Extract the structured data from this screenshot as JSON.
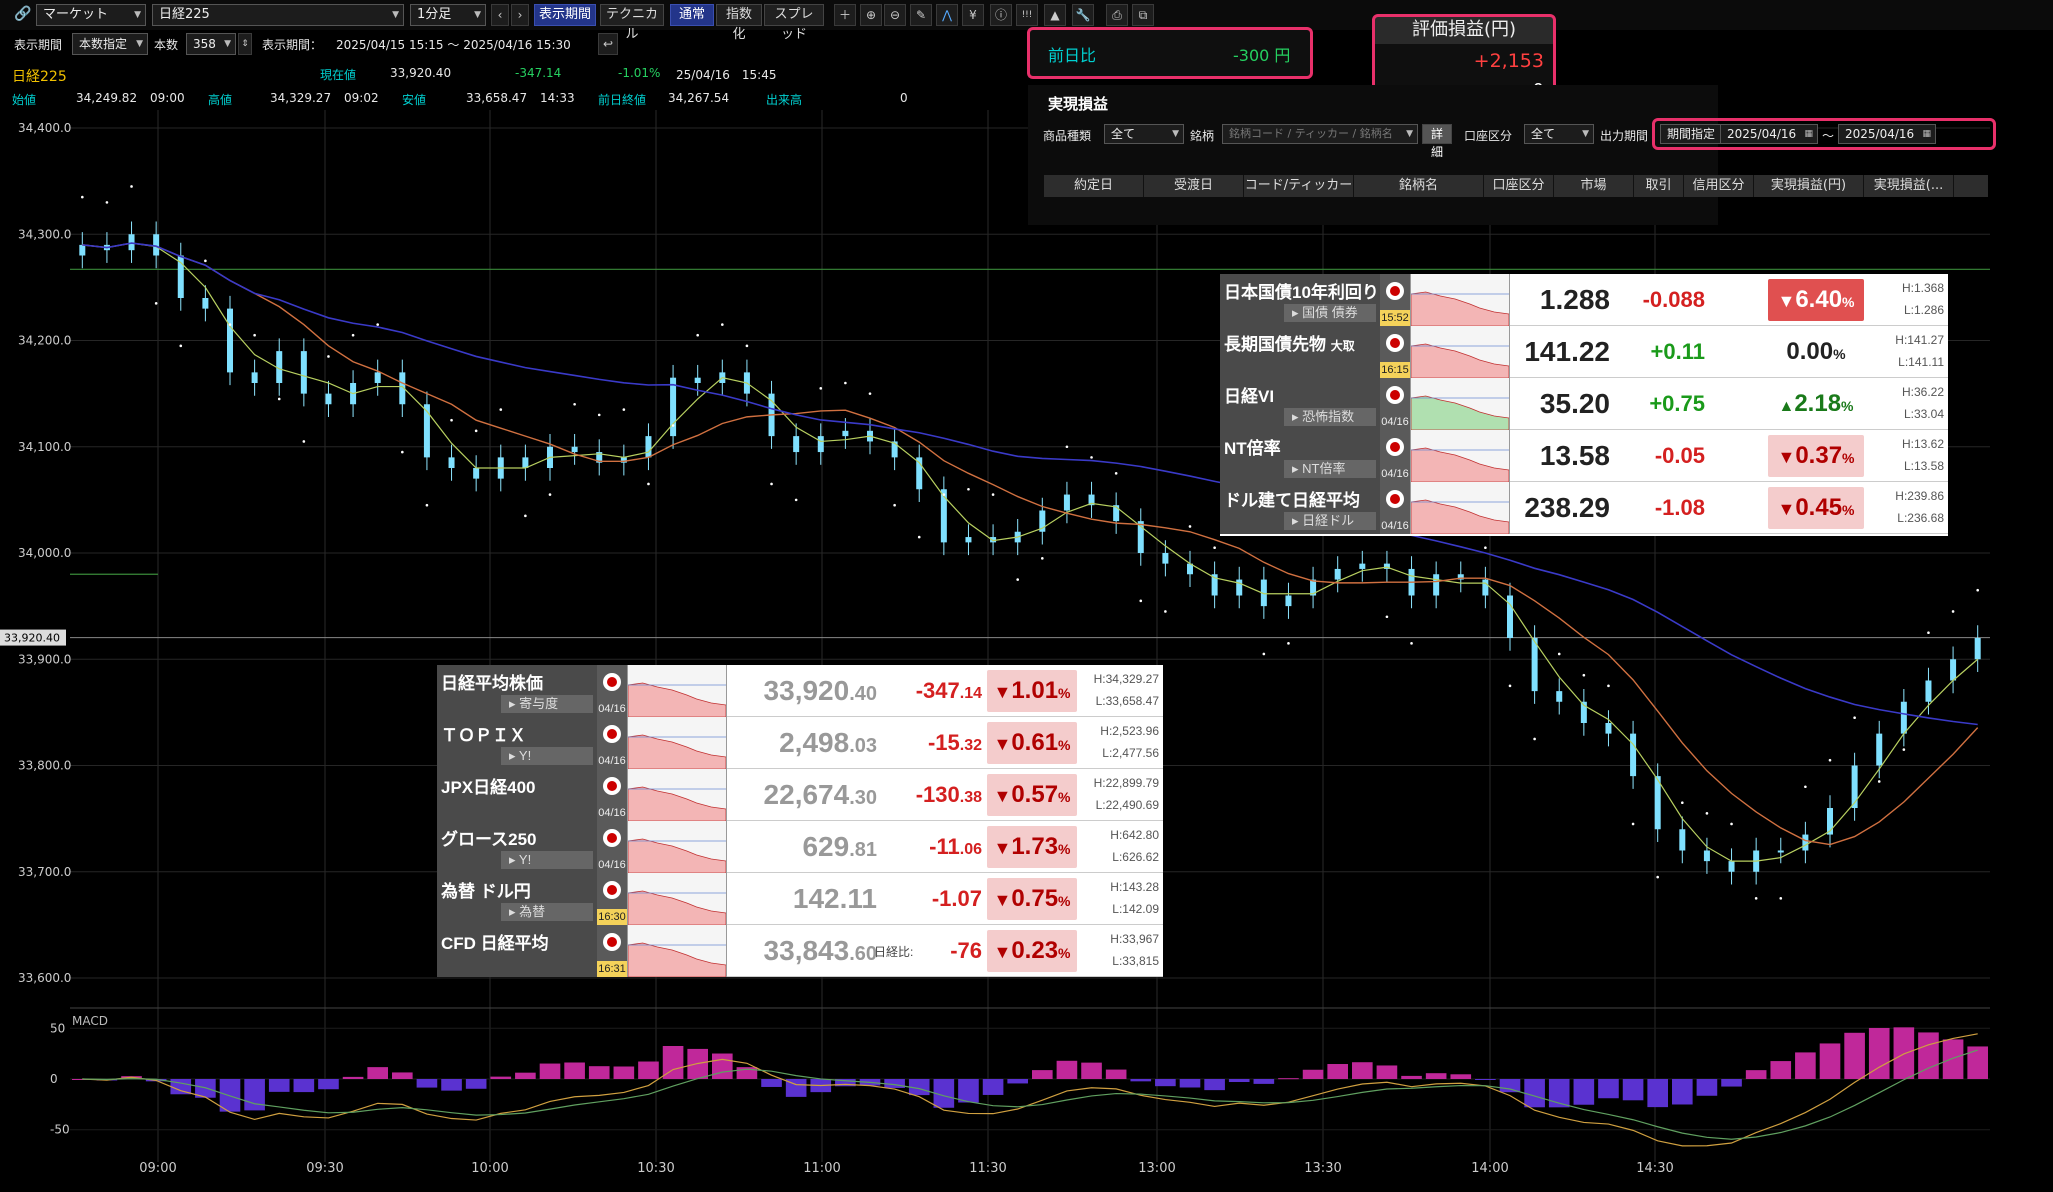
{
  "toolbar": {
    "link_icon": "link-icon",
    "market_select": "マーケット",
    "symbol_select": "日経225",
    "interval_select": "1分足",
    "btn_period": "表示期間",
    "btn_technical": "テクニカル",
    "btn_normal": "通常",
    "btn_index": "指数化",
    "btn_spread": "スプレッド",
    "icons": [
      "crosshair-icon",
      "zoom-in-icon",
      "zoom-out-icon",
      "pen-icon",
      "chart-icon",
      "yen-icon",
      "info-icon",
      "alert-icon",
      "area-chart-icon",
      "wrench-icon",
      "print-icon",
      "new-window-icon"
    ]
  },
  "row2": {
    "period_label": "表示期間",
    "count_mode": "本数指定",
    "count_label": "本数",
    "count_value": "358",
    "range_label": "表示期間：",
    "range_value": "2025/04/15 15:15 ～ 2025/04/16 15:30"
  },
  "quote": {
    "name": "日経225",
    "current_label": "現在値",
    "current": "33,920.40",
    "change": "-347.14",
    "change_pct": "-1.01%",
    "datetime": "25/04/16　15:45",
    "open_label": "始値",
    "open": "34,249.82",
    "open_time": "09:00",
    "high_label": "高値",
    "high": "34,329.27",
    "high_time": "09:02",
    "low_label": "安値",
    "low": "33,658.47",
    "low_time": "14:33",
    "prev_label": "前日終値",
    "prev": "34,267.54",
    "vol_label": "出来高",
    "vol": "0"
  },
  "day_change": {
    "label": "前日比",
    "value": "-300 円"
  },
  "eval_pl": {
    "label": "評価損益(円)",
    "value": "+2,153",
    "value2": "0"
  },
  "realized": {
    "title": "実現損益",
    "product_label": "商品種類",
    "product_value": "全て",
    "symbol_label": "銘柄",
    "symbol_placeholder": "銘柄コード / ティッカー / 銘柄名",
    "detail_btn": "詳細",
    "account_label": "口座区分",
    "account_value": "全て",
    "output_label": "出力期間",
    "period_mode": "期間指定",
    "date_from": "2025/04/16",
    "tilde": "～",
    "date_to": "2025/04/16",
    "columns": [
      "約定日",
      "受渡日",
      "コード/ティッカー",
      "銘柄名",
      "口座区分",
      "市場",
      "取引",
      "信用区分",
      "実現損益(円)",
      "実現損益(..."
    ]
  },
  "chart_data": {
    "type": "candlestick",
    "ylim": [
      33600,
      34400
    ],
    "yticks": [
      "34,400.0",
      "34,300.0",
      "34,200.0",
      "34,100.0",
      "34,000.0",
      "33,900.0",
      "33,800.0",
      "33,700.0",
      "33,600.0"
    ],
    "xticks": [
      "09:00",
      "09:30",
      "10:00",
      "10:30",
      "11:00",
      "11:30",
      "13:00",
      "13:30",
      "14:00",
      "14:30"
    ],
    "current_price_tag": "33,920.40",
    "close_series": [
      34290,
      34285,
      34300,
      34280,
      34240,
      34230,
      34170,
      34160,
      34190,
      34150,
      34140,
      34160,
      34170,
      34140,
      34090,
      34080,
      34070,
      34090,
      34080,
      34100,
      34095,
      34085,
      34090,
      34110,
      34165,
      34160,
      34170,
      34150,
      34110,
      34095,
      34110,
      34115,
      34105,
      34090,
      34060,
      34010,
      34015,
      34010,
      34020,
      34040,
      34055,
      34045,
      34030,
      34000,
      33990,
      33980,
      33960,
      33975,
      33950,
      33960,
      33975,
      33985,
      33990,
      33985,
      33960,
      33980,
      33975,
      33960,
      33920,
      33870,
      33860,
      33840,
      33830,
      33790,
      33740,
      33720,
      33710,
      33700,
      33720,
      33720,
      33735,
      33760,
      33800,
      33830,
      33860,
      33880,
      33900,
      33920
    ],
    "macd_label": "MACD",
    "macd_ylim": [
      -70,
      70
    ],
    "macd_yticks": [
      "50",
      "0",
      "-50"
    ]
  },
  "panel_upper": [
    {
      "name": "日本国債10年利回り",
      "sub": "国債 債券",
      "date": "15:52",
      "price": "1.288",
      "price_dec": "",
      "change": "-0.088",
      "change_dec": "",
      "pct": "6.40",
      "dir": "down",
      "h": "H:1.368",
      "l": "L:1.286"
    },
    {
      "name": "長期国債先物",
      "suffix": "大取",
      "sub": "",
      "date": "16:15",
      "price": "141.22",
      "price_dec": "",
      "change": "+0.11",
      "change_dec": "",
      "pct": "0.00",
      "dir": "flat",
      "h": "H:141.27",
      "l": "L:141.11"
    },
    {
      "name": "日経VI",
      "sub": "恐怖指数",
      "date": "04/16",
      "price": "35.20",
      "price_dec": "",
      "change": "+0.75",
      "change_dec": "",
      "pct": "2.18",
      "dir": "up",
      "h": "H:36.22",
      "l": "L:33.04"
    },
    {
      "name": "NT倍率",
      "sub": "NT倍率",
      "date": "04/16",
      "price": "13.58",
      "price_dec": "",
      "change": "-0.05",
      "change_dec": "",
      "pct": "0.37",
      "dir": "down",
      "h": "H:13.62",
      "l": "L:13.58"
    },
    {
      "name": "ドル建て日経平均",
      "sub": "日経ドル",
      "date": "04/16",
      "price": "238.29",
      "price_dec": "",
      "change": "-1.08",
      "change_dec": "",
      "pct": "0.45",
      "dir": "down",
      "h": "H:239.86",
      "l": "L:236.68"
    }
  ],
  "panel_lower": [
    {
      "name": "日経平均株価",
      "sub": "寄与度",
      "date": "04/16",
      "price": "33,920",
      "price_dec": ".40",
      "change": "-347",
      "change_dec": ".14",
      "pct": "1.01",
      "dir": "down",
      "h": "H:34,329.27",
      "l": "L:33,658.47"
    },
    {
      "name": "ＴＯＰＩＸ",
      "sub": "Y!",
      "date": "04/16",
      "price": "2,498",
      "price_dec": ".03",
      "change": "-15",
      "change_dec": ".32",
      "pct": "0.61",
      "dir": "down",
      "h": "H:2,523.96",
      "l": "L:2,477.56"
    },
    {
      "name": "JPX日経400",
      "sub": "",
      "date": "04/16",
      "price": "22,674",
      "price_dec": ".30",
      "change": "-130",
      "change_dec": ".38",
      "pct": "0.57",
      "dir": "down",
      "h": "H:22,899.79",
      "l": "L:22,490.69"
    },
    {
      "name": "グロース250",
      "sub": "Y!",
      "date": "04/16",
      "price": "629",
      "price_dec": ".81",
      "change": "-11",
      "change_dec": ".06",
      "pct": "1.73",
      "dir": "down",
      "h": "H:642.80",
      "l": "L:626.62"
    },
    {
      "name": "為替 ドル円",
      "sub": "為替",
      "date": "16:30",
      "price": "142.11",
      "price_dec": "",
      "change": "-1.07",
      "change_dec": "",
      "pct": "0.75",
      "dir": "down",
      "h": "H:143.28",
      "l": "L:142.09"
    },
    {
      "name": "CFD 日経平均",
      "sub": "",
      "date": "16:31",
      "price": "33,843",
      "price_dec": ".60",
      "change_label": "日経比:",
      "change": "-76",
      "change_dec": "",
      "pct": "0.23",
      "dir": "down",
      "h": "H:33,967",
      "l": "L:33,815"
    }
  ]
}
